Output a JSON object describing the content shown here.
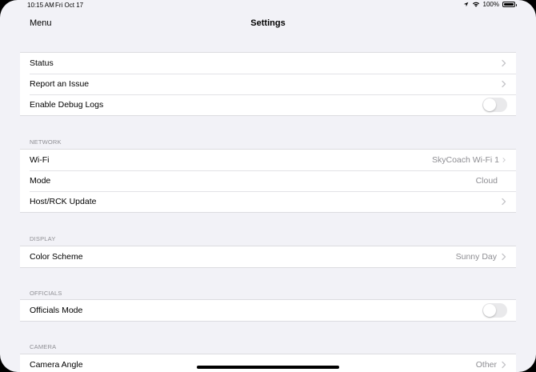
{
  "status_bar": {
    "time": "10:15 AM",
    "date": "Fri Oct 17",
    "battery": "100%",
    "location_icon": "location-arrow-icon",
    "wifi_icon": "wifi-icon",
    "battery_icon": "battery-icon"
  },
  "nav": {
    "menu_label": "Menu",
    "title": "Settings"
  },
  "general": {
    "status_label": "Status",
    "report_label": "Report an Issue",
    "debug_label": "Enable Debug Logs",
    "debug_enabled": false
  },
  "network": {
    "header": "NETWORK",
    "wifi_label": "Wi-Fi",
    "wifi_value": "SkyCoach Wi-Fi 1",
    "mode_label": "Mode",
    "mode_value": "Cloud",
    "host_label": "Host/RCK Update"
  },
  "display": {
    "header": "DISPLAY",
    "color_scheme_label": "Color Scheme",
    "color_scheme_value": "Sunny Day"
  },
  "officials": {
    "header": "OFFICIALS",
    "mode_label": "Officials Mode",
    "mode_enabled": false
  },
  "camera": {
    "header": "CAMERA",
    "angle_label": "Camera Angle",
    "angle_value": "Other"
  },
  "colors": {
    "background": "#f2f2f7",
    "cell": "#ffffff",
    "secondary_text": "#8e8e93",
    "toggle_off": "#e9e9eb"
  }
}
